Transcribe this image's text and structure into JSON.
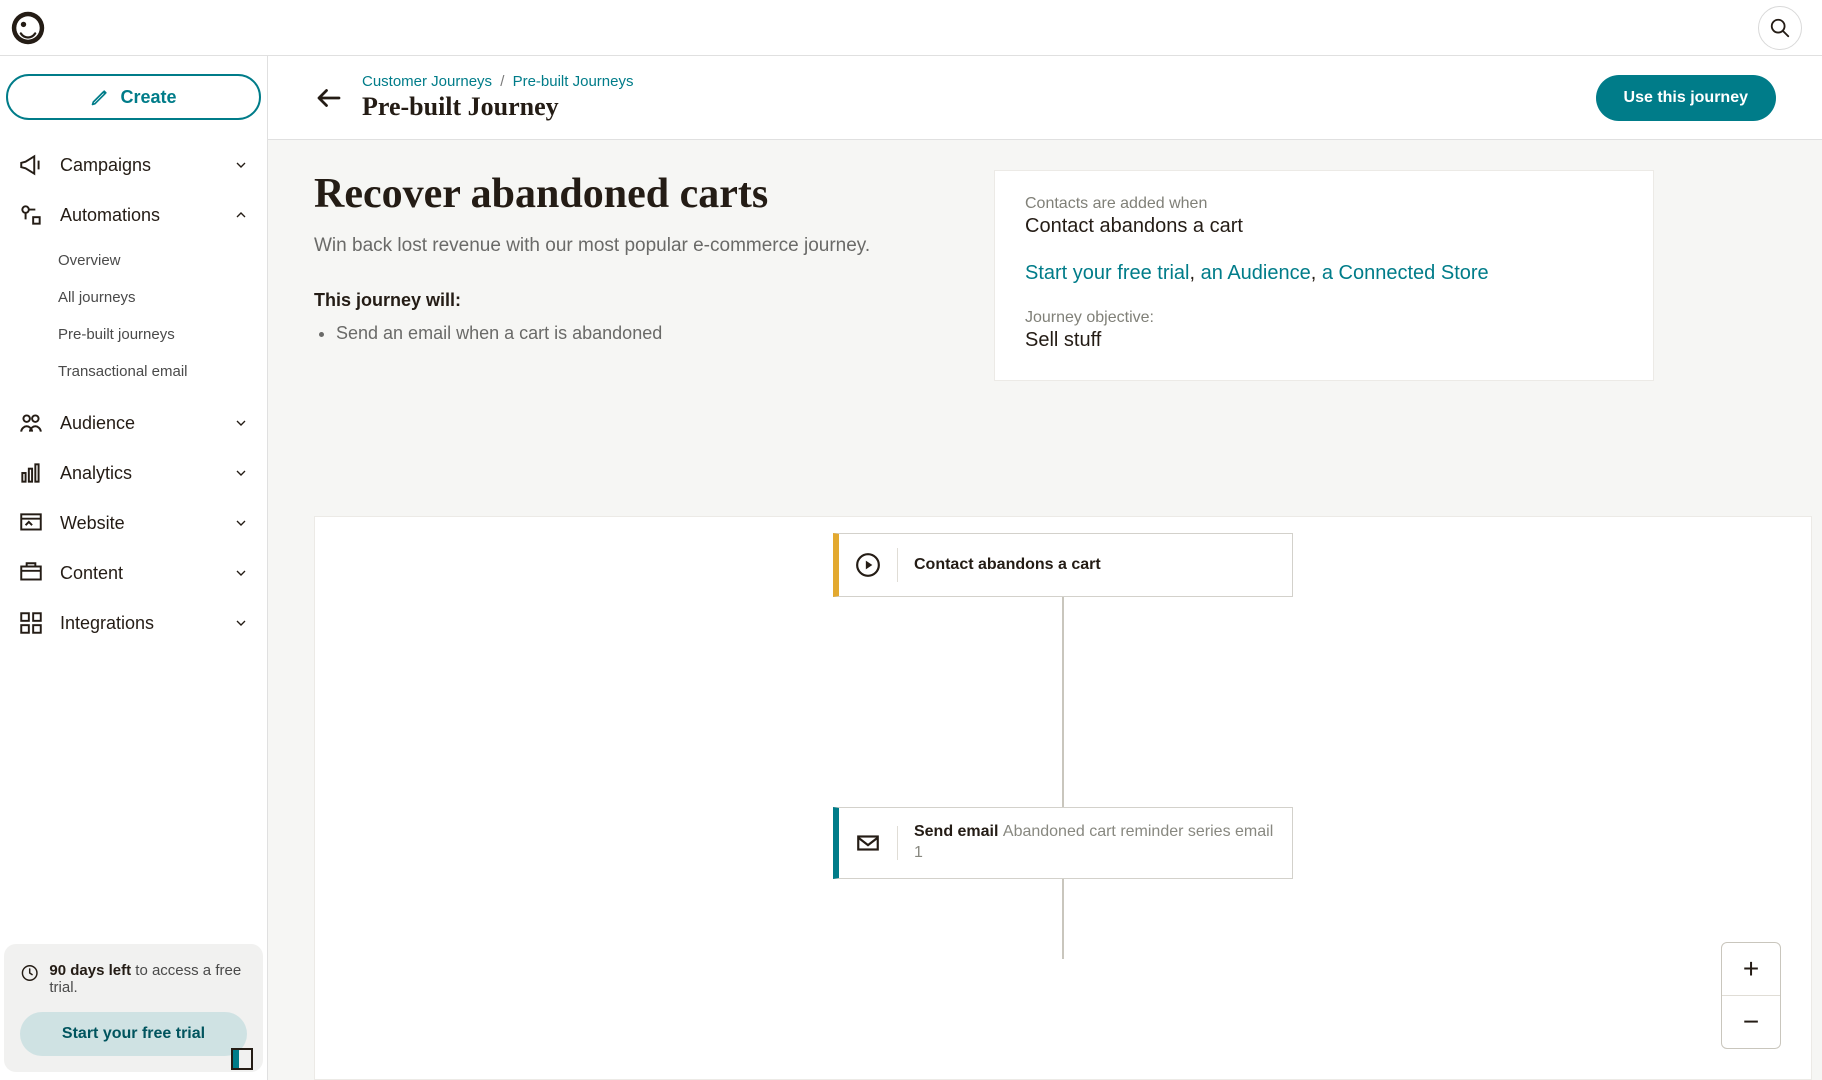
{
  "header": {
    "create_label": "Create"
  },
  "sidebar": {
    "items": [
      {
        "label": "Campaigns",
        "expanded": false
      },
      {
        "label": "Automations",
        "expanded": true,
        "children": [
          {
            "label": "Overview"
          },
          {
            "label": "All journeys"
          },
          {
            "label": "Pre-built journeys"
          },
          {
            "label": "Transactional email"
          }
        ]
      },
      {
        "label": "Audience",
        "expanded": false
      },
      {
        "label": "Analytics",
        "expanded": false
      },
      {
        "label": "Website",
        "expanded": false
      },
      {
        "label": "Content",
        "expanded": false
      },
      {
        "label": "Integrations",
        "expanded": false
      }
    ],
    "trial": {
      "days_left": "90 days left",
      "suffix": " to access a free trial.",
      "button": "Start your free trial"
    }
  },
  "page": {
    "breadcrumbs": [
      {
        "label": "Customer Journeys"
      },
      {
        "label": "Pre-built Journeys"
      }
    ],
    "title": "Pre-built Journey",
    "cta": "Use this journey"
  },
  "summary": {
    "heading": "Recover abandoned carts",
    "description": "Win back lost revenue with our most popular e-commerce journey.",
    "will_heading": "This journey will:",
    "will_items": [
      "Send an email when a cart is abandoned"
    ],
    "panel": {
      "added_when_label": "Contacts are added when",
      "added_when_value": "Contact abandons a cart",
      "links_prefix": "",
      "link_trial": "Start your free trial",
      "link_audience": "an Audience",
      "link_store": "a Connected Store",
      "objective_label": "Journey objective:",
      "objective_value": "Sell stuff"
    }
  },
  "flow": {
    "start_node": {
      "label": "Contact abandons a cart"
    },
    "email_node": {
      "prefix": "Send email ",
      "detail": "Abandoned cart reminder series email 1"
    }
  }
}
